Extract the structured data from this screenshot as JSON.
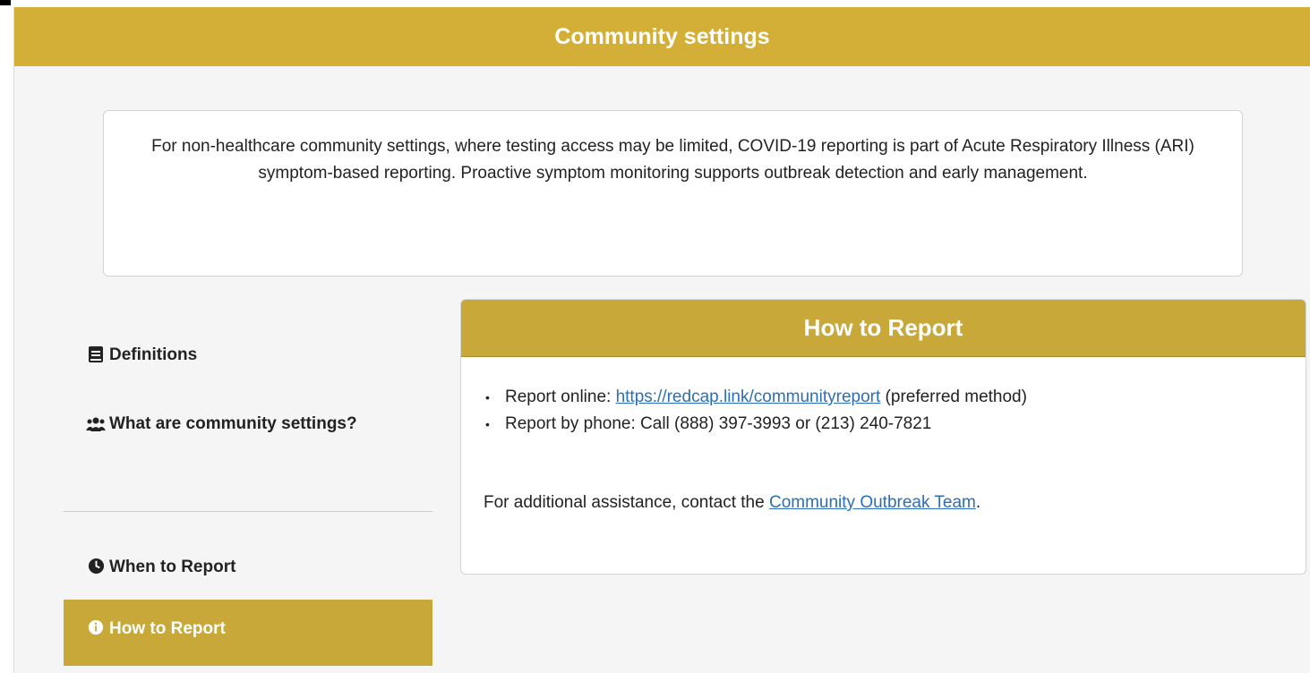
{
  "header": {
    "title": "Community settings"
  },
  "intro": {
    "text": "For non-healthcare community settings, where testing access may be limited, COVID-19 reporting is part of Acute Respiratory Illness (ARI) symptom-based reporting. Proactive symptom monitoring supports outbreak detection and early management."
  },
  "sidenav": {
    "items": [
      {
        "label": "Definitions",
        "icon": "book-icon"
      },
      {
        "label": "What are community settings?",
        "icon": "users-icon"
      },
      {
        "label": "When to Report",
        "icon": "clock-icon"
      },
      {
        "label": "How to Report",
        "icon": "info-icon",
        "active": true
      }
    ]
  },
  "card": {
    "title": "How to Report",
    "online_prefix": "Report online: ",
    "online_link": "https://redcap.link/communityreport",
    "online_suffix": " (preferred method)",
    "phone_text": "Report by phone: Call (888) 397-3993 or (213) 240-7821",
    "assist_prefix": "For additional assistance, contact the ",
    "assist_link": "Community Outbreak Team",
    "assist_suffix": "."
  },
  "colors": {
    "gold": "#d4af37",
    "gold_dark": "#c9a83a",
    "link": "#2a6fb8"
  }
}
